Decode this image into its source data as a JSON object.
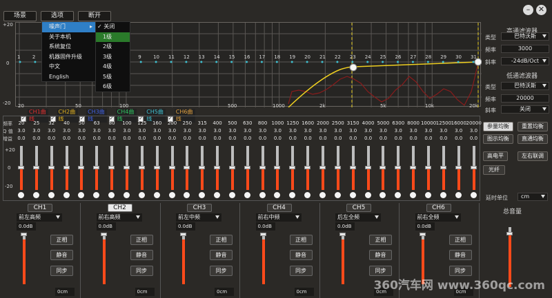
{
  "topbar": {
    "scene": "场景",
    "options": "选项",
    "disconnect": "断开"
  },
  "window": {
    "minimize": "–",
    "close": "✕"
  },
  "graph": {
    "y_labels": [
      "+20",
      "0",
      "-20"
    ],
    "band_numbers": [
      "1",
      "2",
      "3",
      "4",
      "5",
      "6",
      "7",
      "8",
      "9",
      "10",
      "11",
      "12",
      "13",
      "14",
      "15",
      "16",
      "17",
      "18",
      "19",
      "20",
      "21",
      "22",
      "23",
      "24",
      "25",
      "26",
      "27",
      "28",
      "29",
      "30",
      "31"
    ],
    "x_labels": [
      "20",
      "50",
      "100",
      "500",
      "1000",
      "2k",
      "5k",
      "10k",
      "20k"
    ]
  },
  "menu": {
    "items": [
      "噪声门",
      "关于本机",
      "系统复位",
      "机器固件升级",
      "中文",
      "English"
    ]
  },
  "submenu": {
    "items": [
      "关闭",
      "1级",
      "2级",
      "3级",
      "4级",
      "5级",
      "6级"
    ],
    "checked": "关闭",
    "selected": "1级"
  },
  "right": {
    "hp_title": "高通滤波器",
    "type_label": "类型",
    "freq_label": "频率",
    "slope_label": "斜率",
    "hp_type": "巴特沃斯",
    "hp_freq": "3000",
    "hp_slope": "-24dB/Oct",
    "lp_title": "低通滤波器",
    "lp_type": "巴特沃斯",
    "lp_freq": "20000",
    "lp_slope": "关闭",
    "btn_param_eq": "参量均衡",
    "btn_reset_eq": "重置均衡",
    "btn_graphic_eq": "图示均衡",
    "btn_direct_eq": "直通均衡",
    "btn_high_level": "高电平",
    "btn_lr_link": "左右联调",
    "btn_optical": "光纤",
    "delay_unit_label": "延时单位",
    "delay_unit": "cm",
    "master_volume": "总音量"
  },
  "legend": [
    "CH1曲线",
    "CH2曲线",
    "CH3曲线",
    "CH4曲线",
    "CH5曲线",
    "CH6曲线"
  ],
  "legend_colors": [
    "#e03030",
    "#e0b020",
    "#4060e0",
    "#30c060",
    "#40c0d0",
    "#e0a040"
  ],
  "eq_table": {
    "row_labels": [
      "频率",
      "Q 值",
      "增益"
    ],
    "freqs": [
      "20",
      "25",
      "32",
      "40",
      "50",
      "63",
      "80",
      "100",
      "125",
      "160",
      "200",
      "250",
      "315",
      "400",
      "500",
      "630",
      "800",
      "1000",
      "1250",
      "1600",
      "2000",
      "2500",
      "3150",
      "4000",
      "5000",
      "6300",
      "8000",
      "10000",
      "12500",
      "16000",
      "20000"
    ],
    "q": "3.0",
    "gain": "0.0"
  },
  "eq_scale": [
    "+20",
    "0",
    "-20"
  ],
  "channels": [
    {
      "name": "CH1",
      "output": "前左高频",
      "level": "0.0dB",
      "delay": "0cm"
    },
    {
      "name": "CH2",
      "output": "前右高频",
      "level": "0.0dB",
      "delay": "0cm"
    },
    {
      "name": "CH3",
      "output": "前左中频",
      "level": "0.0dB",
      "delay": "0cm"
    },
    {
      "name": "CH4",
      "output": "前右中频",
      "level": "0.0dB",
      "delay": "0cm"
    },
    {
      "name": "CH5",
      "output": "后左全频",
      "level": "0.0dB",
      "delay": "0cm"
    },
    {
      "name": "CH6",
      "output": "前右全频",
      "level": "0.0dB",
      "delay": "0cm"
    }
  ],
  "ch_buttons": {
    "phase": "正相",
    "mute": "静音",
    "sync": "同步"
  },
  "watermark": "360汽车网 www.360qc.com"
}
